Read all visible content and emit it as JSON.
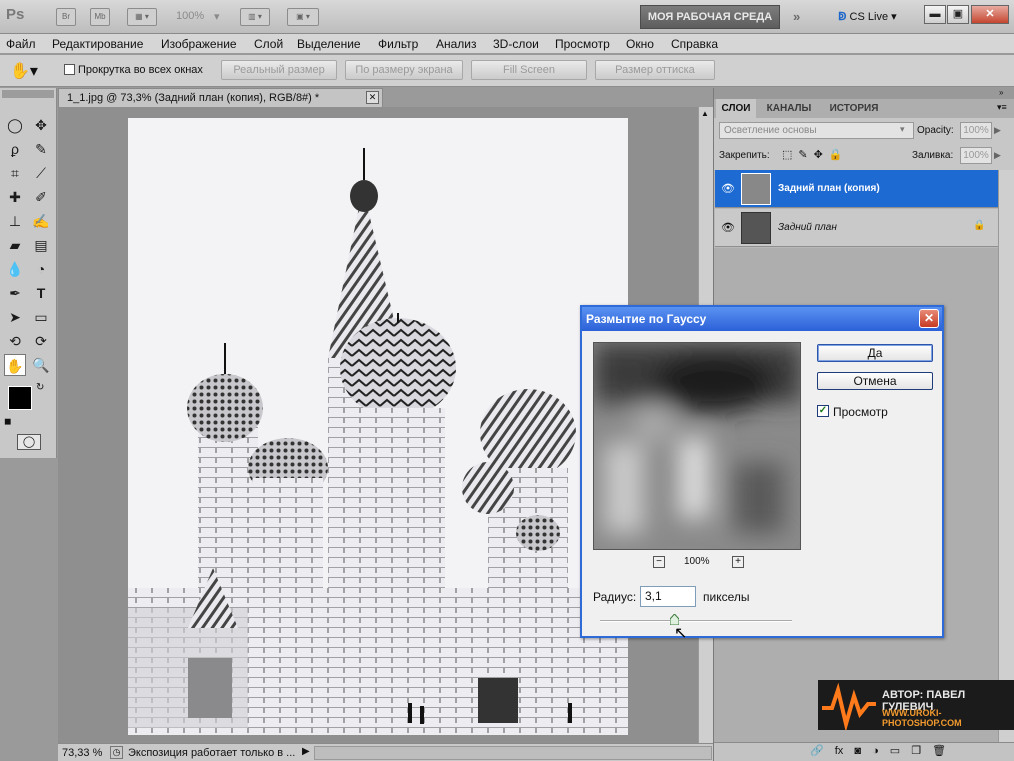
{
  "app": {
    "logo": "Ps",
    "bridge": "Br",
    "minibridge": "Mb",
    "zoom": "100%",
    "workspace_button": "МОЯ РАБОЧАЯ СРЕДА",
    "cslive": "CS Live"
  },
  "menu": [
    "Файл",
    "Редактирование",
    "Изображение",
    "Слой",
    "Выделение",
    "Фильтр",
    "Анализ",
    "3D-слои",
    "Просмотр",
    "Окно",
    "Справка"
  ],
  "options": {
    "scroll_all_windows": "Прокрутка во всех окнах",
    "buttons": [
      "Реальный размер",
      "По размеру экрана",
      "Fill Screen",
      "Размер оттиска"
    ]
  },
  "document": {
    "tab_title": "1_1.jpg @ 73,3% (Задний план (копия), RGB/8#) *",
    "zoom": "73,33 %",
    "status_text": "Экспозиция работает только в ..."
  },
  "layers_panel": {
    "tabs": [
      "СЛОИ",
      "КАНАЛЫ",
      "ИСТОРИЯ"
    ],
    "blend_mode": "Осветление основы",
    "opacity_label": "Opacity:",
    "opacity_value": "100%",
    "lock_label": "Закрепить:",
    "fill_label": "Заливка:",
    "fill_value": "100%",
    "layers": [
      {
        "name": "Задний план (копия)",
        "selected": true
      },
      {
        "name": "Задний план",
        "selected": false
      }
    ]
  },
  "dialog": {
    "title": "Размытие по Гауссу",
    "ok_button": "Да",
    "cancel_button": "Отмена",
    "preview_label": "Просмотр",
    "preview_checked": true,
    "preview_zoom": "100%",
    "radius_label": "Радиус:",
    "radius_value": "3,1",
    "units": "пикселы",
    "slider_fraction": 0.39
  },
  "watermark": {
    "author": "АВТОР: ПАВЕЛ ГУЛЕВИЧ",
    "site": "WWW.UROKI-PHOTOSHOP.COM"
  },
  "colors": {
    "selection_blue": "#1e6ad3",
    "dialog_title": "#2b61d7"
  }
}
